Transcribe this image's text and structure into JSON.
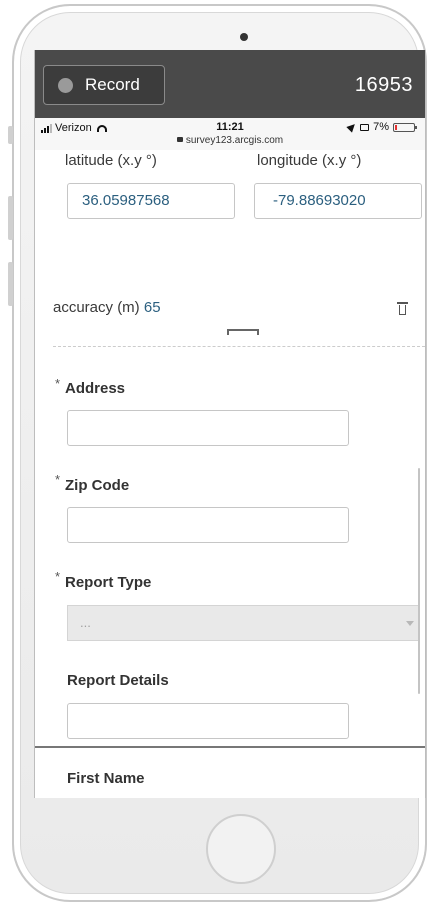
{
  "recorder": {
    "label": "Record",
    "count": "16953"
  },
  "statusbar": {
    "carrier": "Verizon",
    "time": "11:21",
    "url": "survey123.arcgis.com",
    "battery": "7%"
  },
  "location": {
    "latitude_label": "latitude (x.y °)",
    "longitude_label": "longitude (x.y °)",
    "latitude_value": "36.05987568",
    "longitude_value": "-79.88693020",
    "accuracy_label": "accuracy (m)",
    "accuracy_value": "65"
  },
  "form": {
    "required_mark": "*",
    "address_label": "Address",
    "zip_label": "Zip Code",
    "report_type_label": "Report Type",
    "report_type_value": "...",
    "report_details_label": "Report Details",
    "first_name_label": "First Name"
  },
  "icons": [
    "record-icon",
    "signal-icon",
    "wifi-icon",
    "lock-icon",
    "location-arrow-icon",
    "screen-mirror-icon",
    "battery-icon",
    "trash-icon",
    "drag-handle-icon",
    "dropdown-caret-icon",
    "home-button"
  ],
  "colors": {
    "value_text": "#2b5f7f",
    "recorder_bar": "#4a4a4a",
    "battery_low": "#e63232"
  }
}
